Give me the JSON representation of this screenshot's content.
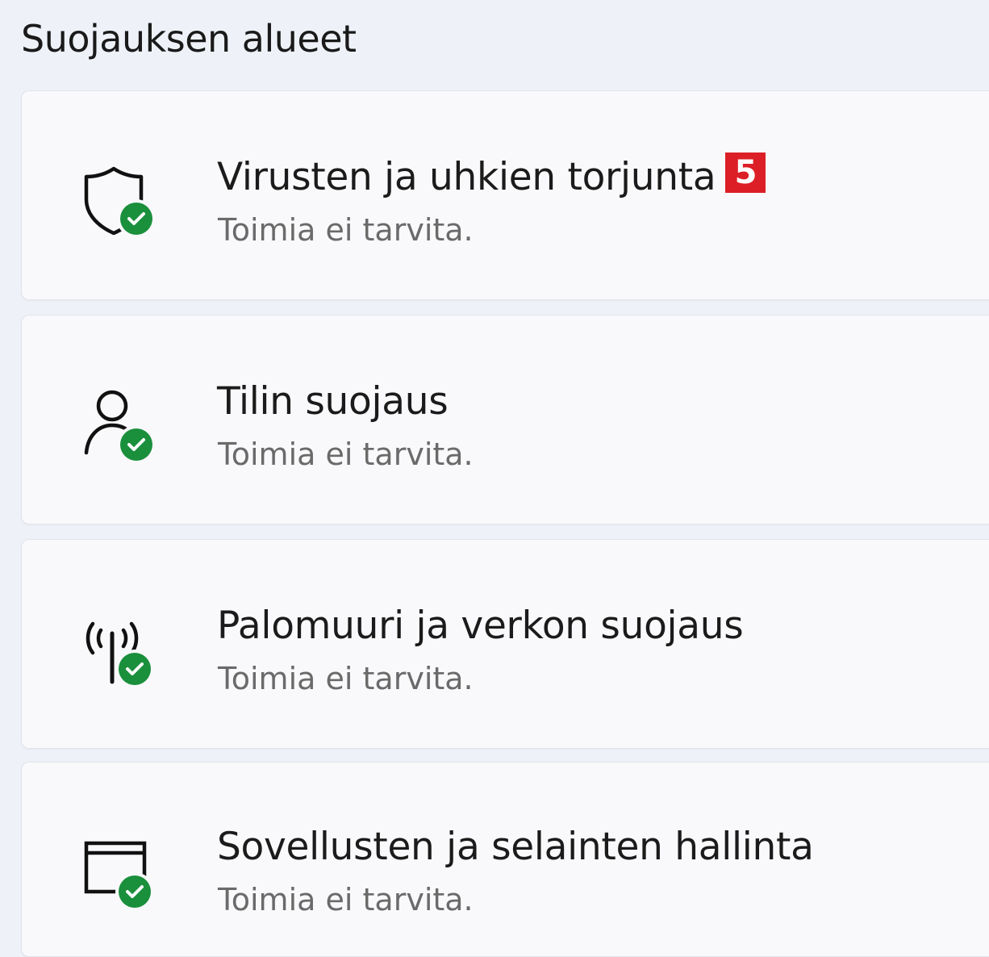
{
  "section": {
    "title": "Suojauksen alueet"
  },
  "areas": [
    {
      "title": "Virusten ja uhkien torjunta",
      "status": "Toimia ei tarvita.",
      "icon": "shield-check-icon",
      "badge": "5"
    },
    {
      "title": "Tilin suojaus",
      "status": "Toimia ei tarvita.",
      "icon": "person-check-icon"
    },
    {
      "title": "Palomuuri ja verkon suojaus",
      "status": "Toimia ei tarvita.",
      "icon": "antenna-check-icon"
    },
    {
      "title": "Sovellusten ja selainten hallinta",
      "status": "Toimia ei tarvita.",
      "icon": "app-window-check-icon"
    }
  ],
  "colors": {
    "status_ok": "#1a8f3c",
    "badge": "#dc1f26",
    "card_bg": "#f9f9fb",
    "page_bg": "#eef2f8"
  }
}
